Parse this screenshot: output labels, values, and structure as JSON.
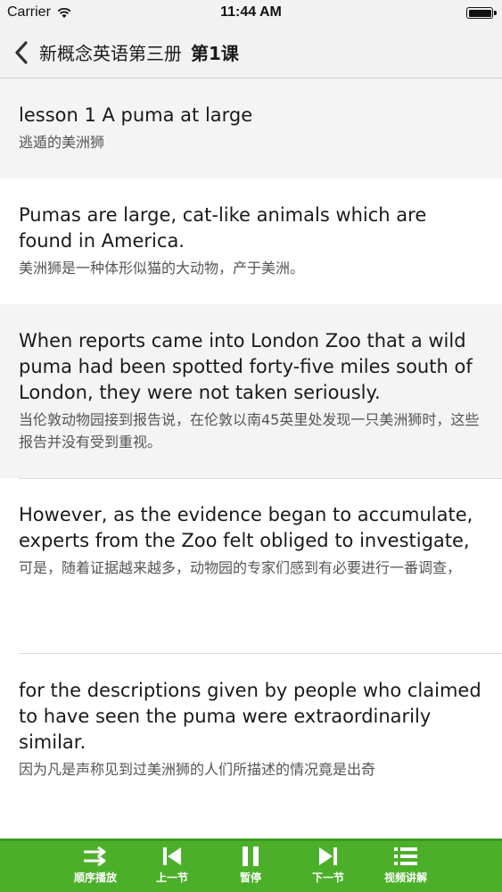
{
  "status_bar": {
    "carrier": "Carrier",
    "time": "11:44 AM"
  },
  "nav": {
    "title": "新概念英语第三册",
    "lesson": "第1课"
  },
  "sentences": [
    {
      "en": "lesson 1  A puma at large",
      "cn": "逃遁的美洲狮"
    },
    {
      "en": "Pumas are large, cat-like animals which are found in America.",
      "cn": "美洲狮是一种体形似猫的大动物，产于美洲。"
    },
    {
      "en": "When reports came into London Zoo that a wild puma had been spotted forty-five miles south of London, they were not taken seriously.",
      "cn": "当伦敦动物园接到报告说，在伦敦以南45英里处发现一只美洲狮时，这些报告并没有受到重视。"
    },
    {
      "en": "However, as the evidence began to accumulate, experts from the Zoo felt obliged to investigate,",
      "cn": "可是，随着证据越来越多，动物园的专家们感到有必要进行一番调查，"
    },
    {
      "en": "for the descriptions given by people who claimed to have seen the puma were extraordinarily similar.",
      "cn": "因为凡是声称见到过美洲狮的人们所描述的情况竟是出奇"
    }
  ],
  "toolbar": {
    "sequential": "顺序播放",
    "prev": "上一节",
    "pause": "暂停",
    "next": "下一节",
    "video": "视频讲解"
  },
  "colors": {
    "toolbar_bg": "#4caf2a",
    "highlight_row": "#f4f4f4"
  }
}
